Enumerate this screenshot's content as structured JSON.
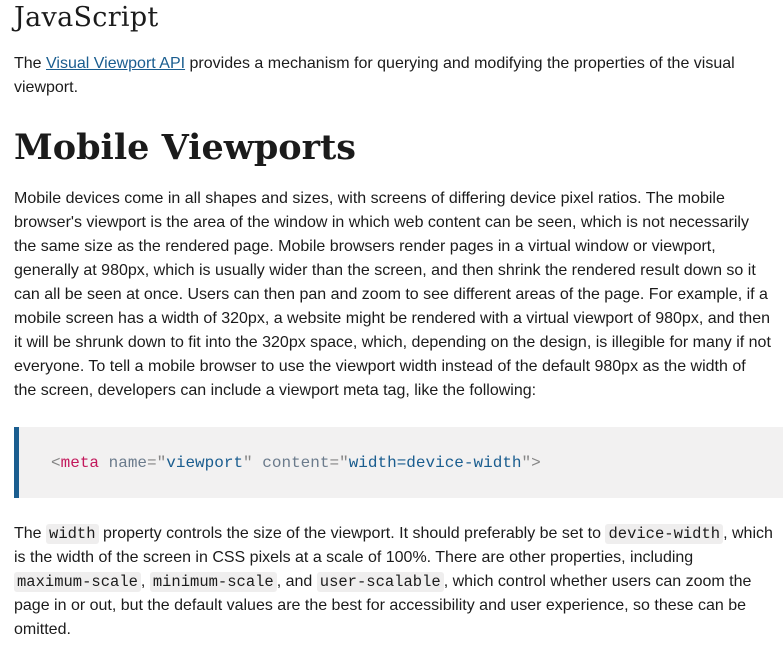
{
  "section_heading": "JavaScript",
  "intro": {
    "prefix": "The ",
    "link_text": "Visual Viewport API",
    "suffix": " provides a mechanism for querying and modifying the properties of the visual viewport."
  },
  "title": "Mobile Viewports",
  "para1": "Mobile devices come in all shapes and sizes, with screens of differing device pixel ratios. The mobile browser's viewport is the area of the window in which web content can be seen, which is not necessarily the same size as the rendered page. Mobile browsers render pages in a virtual window or viewport, generally at 980px, which is usually wider than the screen, and then shrink the rendered result down so it can all be seen at once. Users can then pan and zoom to see different areas of the page. For example, if a mobile screen has a width of 320px, a website might be rendered with a virtual viewport of 980px, and then it will be shrunk down to fit into the 320px space, which, depending on the design, is illegible for many if not everyone. To tell a mobile browser to use the viewport width instead of the default 980px as the width of the screen, developers can include a viewport meta tag, like the following:",
  "code": {
    "open": "<",
    "tag": "meta",
    "attr1": "name",
    "eq1": "=\"",
    "val1": "viewport",
    "q1": "\"",
    "attr2": "content",
    "eq2": "=\"",
    "val2": "width=device-width",
    "close": "\">"
  },
  "para2": {
    "t1": "The ",
    "c1": "width",
    "t2": " property controls the size of the viewport. It should preferably be set to ",
    "c2": "device-width",
    "t3": ", which is the width of the screen in CSS pixels at a scale of 100%. There are other properties, including ",
    "c3": "maximum-scale",
    "t4": ", ",
    "c4": "minimum-scale",
    "t5": ", and ",
    "c5": "user-scalable",
    "t6": ", which control whether users can zoom the page in or out, but the default values are the best for accessibility and user experience, so these can be omitted."
  }
}
